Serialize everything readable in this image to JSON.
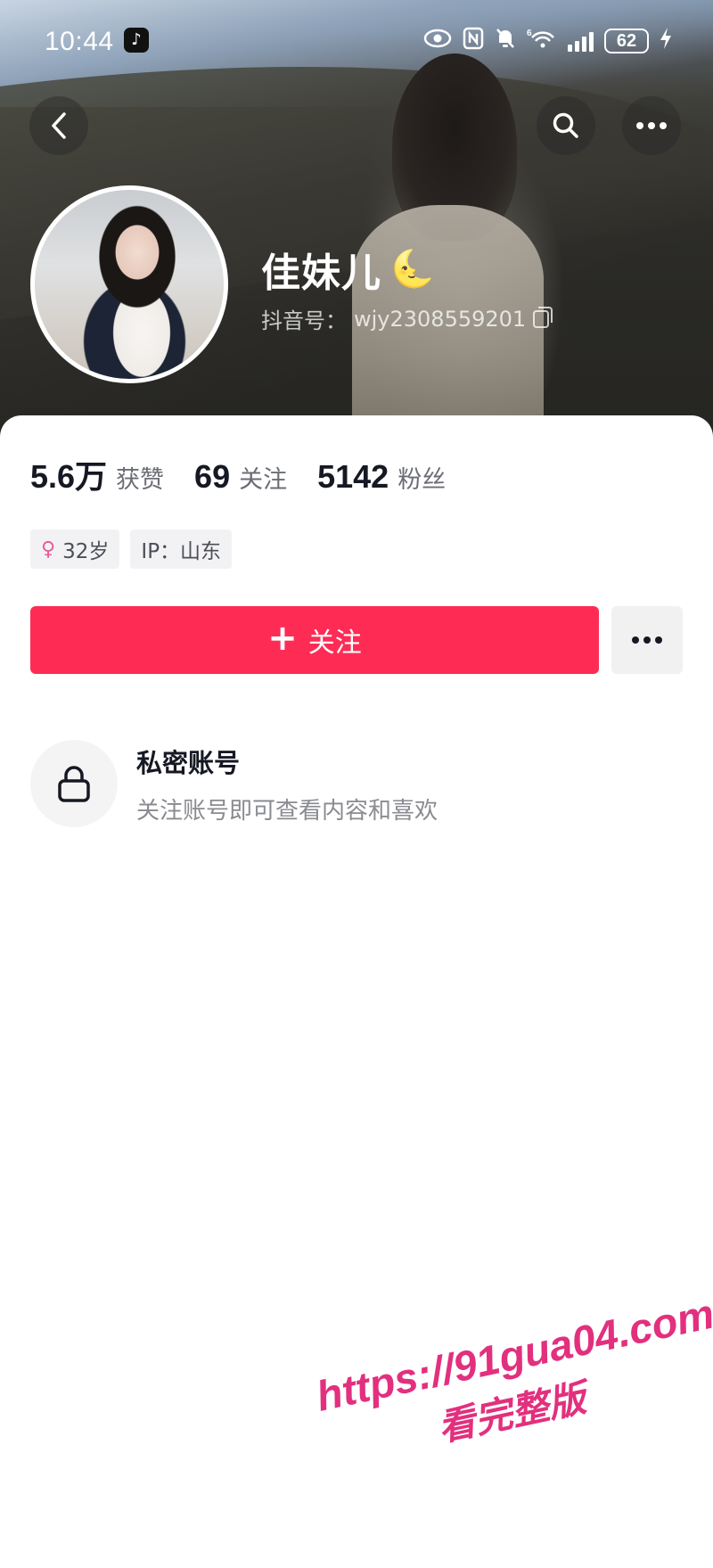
{
  "status_bar": {
    "time": "10:44",
    "battery": "62",
    "network": "6"
  },
  "nav": {
    "back_icon": "chevron-left-icon",
    "search_icon": "search-icon",
    "more_icon": "more-horizontal-icon"
  },
  "profile": {
    "name": "佳妹儿",
    "name_emoji": "🌜",
    "uid_label": "抖音号：",
    "uid_value": "wjy2308559201"
  },
  "stats": [
    {
      "value": "5.6万",
      "label": "获赞"
    },
    {
      "value": "69",
      "label": "关注"
    },
    {
      "value": "5142",
      "label": "粉丝"
    }
  ],
  "tags": [
    {
      "icon": "female-icon",
      "text": "32岁"
    },
    {
      "text": "IP：山东"
    }
  ],
  "actions": {
    "follow_label": "关注",
    "follow_color": "#fe2c55"
  },
  "private": {
    "title": "私密账号",
    "description": "关注账号即可查看内容和喜欢"
  },
  "watermark": {
    "url": "https://91gua04.com",
    "sub": "看完整版"
  }
}
